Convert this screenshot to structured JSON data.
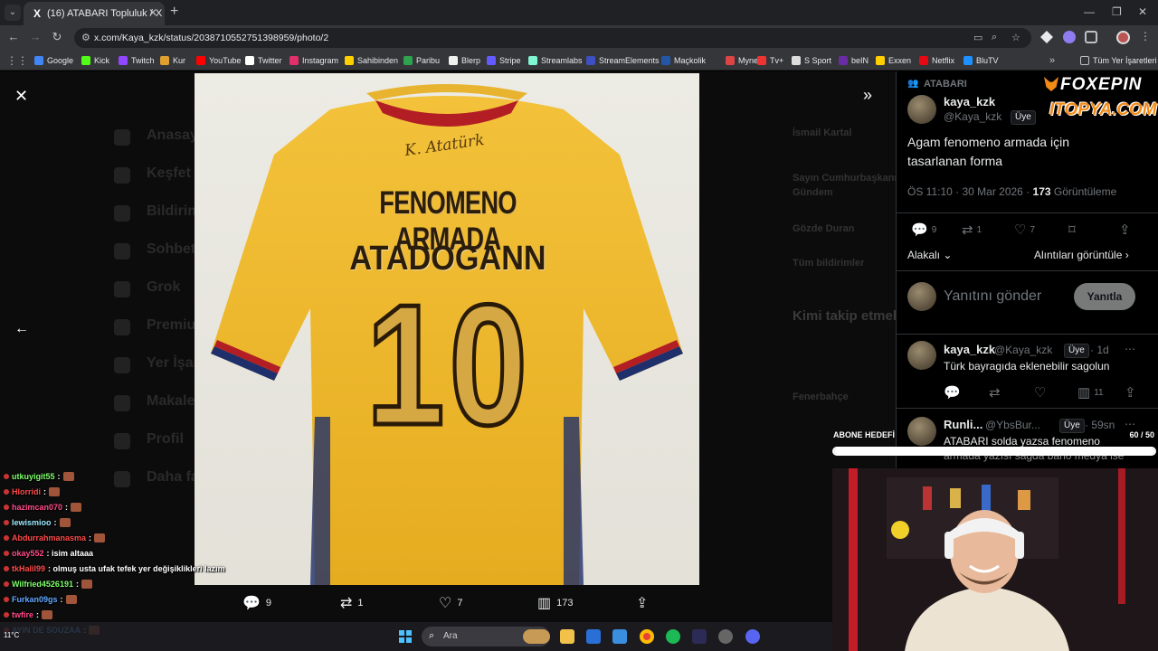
{
  "browser": {
    "tab_title": "(16) ATABARI Topluluk / X",
    "tab_close": "✕",
    "new_tab": "+",
    "url": "x.com/Kaya_kzk/status/2038710552751398959/photo/2",
    "bookmarks": [
      "Google",
      "Kick",
      "Twitch",
      "Kur",
      "YouTube",
      "Twitter",
      "Instagram",
      "Sahibinden",
      "Paribu",
      "Blerp",
      "Stripe",
      "Streamlabs",
      "StreamElements",
      "Maçkolik",
      "Mynet",
      "Tv+",
      "S Sport",
      "beIN",
      "Exxen",
      "Netflix",
      "BluTV"
    ],
    "bookmark_colors": [
      "#4285f4",
      "#53fc18",
      "#9146ff",
      "#e0a030",
      "#ff0000",
      "#ffffff",
      "#e1306c",
      "#ffd000",
      "#2ea44f",
      "#f0f0f0",
      "#635bff",
      "#80f5d2",
      "#3d4fc2",
      "#2456a8",
      "#d44",
      "#e33",
      "#ddd",
      "#6a2ca5",
      "#ffcf00",
      "#e50914",
      "#1e90ff"
    ],
    "all_bookmarks": "Tüm Yer İşaretleri"
  },
  "bg": {
    "nav": [
      "Anasayfa",
      "Keşfet",
      "Bildirimler",
      "Sohbet",
      "Grok",
      "Premium",
      "Yer İşaretleri",
      "Makaleler",
      "Profil",
      "Daha fazla"
    ],
    "right": [
      "İsmail Kartal",
      "Sayın Cumhurbaşkanı",
      "Gündem",
      "Gözde Duran",
      "Tüm bildirimler",
      "Kimi takip etmeli",
      "Fenerbahçe"
    ]
  },
  "viewer": {
    "close_icon": "✕",
    "prev_icon": "←",
    "collapse_icon": "»"
  },
  "photo": {
    "signature": "K. Atatürk",
    "team": "FENOMENO ARMADA",
    "player": "ATADOGANN",
    "number": "10"
  },
  "actions": {
    "replies": "9",
    "reposts": "1",
    "likes": "7",
    "views": "173"
  },
  "panel": {
    "community": "ATABARI",
    "author_name": "kaya_kzk",
    "author_handle": "@Kaya_kzk",
    "member_badge": "Üye",
    "tweet_text": "Agam fenomeno armada için tasarlanan forma",
    "timestamp": "ÖS 11:10 · 30 Mar 2026 ·",
    "views_count": "173",
    "views_label": "Görüntüleme",
    "stat_replies": "9",
    "stat_reposts": "1",
    "stat_likes": "7",
    "sort_label": "Alakalı",
    "quotes_label": "Alıntıları görüntüle",
    "reply_placeholder": "Yanıtını gönder",
    "reply_button": "Yanıtla",
    "replies": [
      {
        "name": "kaya_kzk",
        "handle": "@Kaya_kzk",
        "badge": "Üye",
        "time": "· 1d",
        "text": "Türk bayragıda  eklenebilir sagolun",
        "views": "11"
      },
      {
        "name": "Runli...",
        "handle": "@YbsBur...",
        "badge": "Üye",
        "time": "· 59sn",
        "text": "ATABARI solda yazsa fenomeno",
        "text2": "armada yazısı sağda baho medya ise"
      }
    ]
  },
  "overlay": {
    "brand_1": "FOXEPIN",
    "brand_2": "ITOPYA.COM",
    "sub_goal_label": "ABONE HEDEFİ",
    "sub_goal_count": "60 / 50",
    "sub_goal_progress": 1.0
  },
  "chat": [
    {
      "user": "utkuyigit55",
      "color": "#7fff6a",
      "msg": ":"
    },
    {
      "user": "Hlorridi",
      "color": "#ff4b4b",
      "msg": ":"
    },
    {
      "user": "hazimcan070",
      "color": "#ff4b8a",
      "msg": ":"
    },
    {
      "user": "lewismioo",
      "color": "#9be8ff",
      "msg": ":"
    },
    {
      "user": "Abdurrahmanasma",
      "color": "#ff4b4b",
      "msg": ":"
    },
    {
      "user": "okay552",
      "color": "#ff4b8a",
      "msg": ": isim altaaa"
    },
    {
      "user": "tkHalil99",
      "color": "#ff4b4b",
      "msg": ": olmuş usta ufak tefek yer değişiklikleri lazım"
    },
    {
      "user": "Wilfried4526191",
      "color": "#7fff6a",
      "msg": ":"
    },
    {
      "user": "Furkan09gs",
      "color": "#62a8ff",
      "msg": ":"
    },
    {
      "user": "twfire",
      "color": "#ff4b8a",
      "msg": ":"
    },
    {
      "user": "AYIN DE SOUZAA",
      "color": "#62a8ff",
      "msg": ":"
    }
  ],
  "taskbar": {
    "search_placeholder": "Ara",
    "weather": "11°C"
  }
}
